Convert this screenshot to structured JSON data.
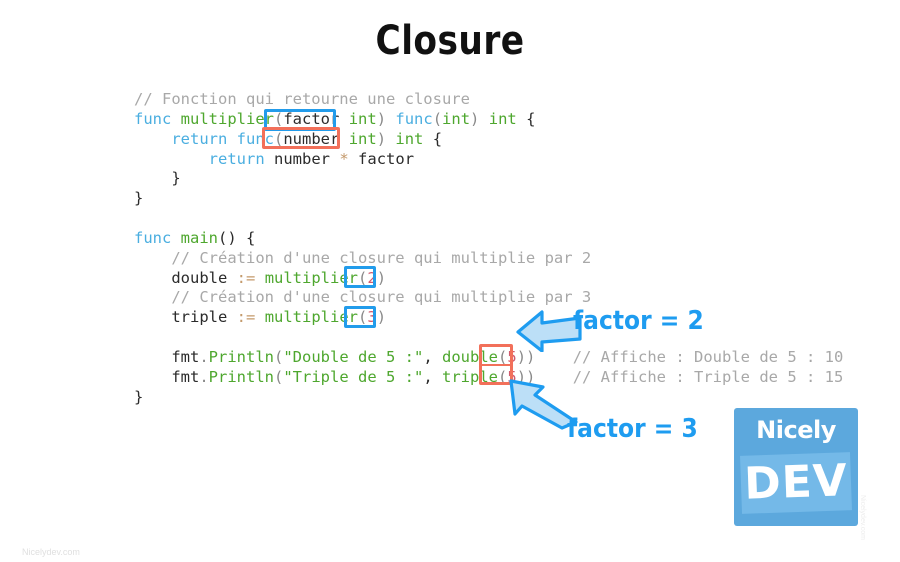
{
  "slide": {
    "title": "Closure",
    "background_color": "#ffffff"
  },
  "code": {
    "language": "go",
    "lines": [
      [
        {
          "t": "// Fonction qui retourne une closure",
          "c": "tok-com"
        }
      ],
      [
        {
          "t": "func",
          "c": "tok-kw"
        },
        {
          "t": " ",
          "c": "tok-plain"
        },
        {
          "t": "multiplier",
          "c": "tok-fn"
        },
        {
          "t": "(",
          "c": "tok-punct"
        },
        {
          "t": "factor",
          "c": "tok-ident"
        },
        {
          "t": " ",
          "c": "tok-plain"
        },
        {
          "t": "int",
          "c": "tok-type"
        },
        {
          "t": ")",
          "c": "tok-punct"
        },
        {
          "t": " ",
          "c": "tok-plain"
        },
        {
          "t": "func",
          "c": "tok-kw"
        },
        {
          "t": "(",
          "c": "tok-punct"
        },
        {
          "t": "int",
          "c": "tok-type"
        },
        {
          "t": ")",
          "c": "tok-punct"
        },
        {
          "t": " ",
          "c": "tok-plain"
        },
        {
          "t": "int",
          "c": "tok-type"
        },
        {
          "t": " {",
          "c": "tok-plain"
        }
      ],
      [
        {
          "t": "    ",
          "c": "tok-plain"
        },
        {
          "t": "return",
          "c": "tok-kw"
        },
        {
          "t": " ",
          "c": "tok-plain"
        },
        {
          "t": "func",
          "c": "tok-kw"
        },
        {
          "t": "(",
          "c": "tok-punct"
        },
        {
          "t": "number",
          "c": "tok-ident"
        },
        {
          "t": " ",
          "c": "tok-plain"
        },
        {
          "t": "int",
          "c": "tok-type"
        },
        {
          "t": ")",
          "c": "tok-punct"
        },
        {
          "t": " ",
          "c": "tok-plain"
        },
        {
          "t": "int",
          "c": "tok-type"
        },
        {
          "t": " {",
          "c": "tok-plain"
        }
      ],
      [
        {
          "t": "        ",
          "c": "tok-plain"
        },
        {
          "t": "return",
          "c": "tok-kw"
        },
        {
          "t": " ",
          "c": "tok-plain"
        },
        {
          "t": "number",
          "c": "tok-ident"
        },
        {
          "t": " ",
          "c": "tok-plain"
        },
        {
          "t": "*",
          "c": "tok-op"
        },
        {
          "t": " ",
          "c": "tok-plain"
        },
        {
          "t": "factor",
          "c": "tok-ident"
        }
      ],
      [
        {
          "t": "    }",
          "c": "tok-plain"
        }
      ],
      [
        {
          "t": "}",
          "c": "tok-plain"
        }
      ],
      [
        {
          "t": "",
          "c": "tok-plain"
        }
      ],
      [
        {
          "t": "func",
          "c": "tok-kw"
        },
        {
          "t": " ",
          "c": "tok-plain"
        },
        {
          "t": "main",
          "c": "tok-fn"
        },
        {
          "t": "() {",
          "c": "tok-plain"
        }
      ],
      [
        {
          "t": "    ",
          "c": "tok-plain"
        },
        {
          "t": "// Création d'une closure qui multiplie par 2",
          "c": "tok-com"
        }
      ],
      [
        {
          "t": "    ",
          "c": "tok-plain"
        },
        {
          "t": "double",
          "c": "tok-ident"
        },
        {
          "t": " ",
          "c": "tok-plain"
        },
        {
          "t": ":=",
          "c": "tok-op"
        },
        {
          "t": " ",
          "c": "tok-plain"
        },
        {
          "t": "multiplier",
          "c": "tok-fn"
        },
        {
          "t": "(",
          "c": "tok-punct"
        },
        {
          "t": "2",
          "c": "tok-num"
        },
        {
          "t": ")",
          "c": "tok-punct"
        }
      ],
      [
        {
          "t": "    ",
          "c": "tok-plain"
        },
        {
          "t": "// Création d'une closure qui multiplie par 3",
          "c": "tok-com"
        }
      ],
      [
        {
          "t": "    ",
          "c": "tok-plain"
        },
        {
          "t": "triple",
          "c": "tok-ident"
        },
        {
          "t": " ",
          "c": "tok-plain"
        },
        {
          "t": ":=",
          "c": "tok-op"
        },
        {
          "t": " ",
          "c": "tok-plain"
        },
        {
          "t": "multiplier",
          "c": "tok-fn"
        },
        {
          "t": "(",
          "c": "tok-punct"
        },
        {
          "t": "3",
          "c": "tok-num"
        },
        {
          "t": ")",
          "c": "tok-punct"
        }
      ],
      [
        {
          "t": "",
          "c": "tok-plain"
        }
      ],
      [
        {
          "t": "    ",
          "c": "tok-plain"
        },
        {
          "t": "fmt",
          "c": "tok-ident"
        },
        {
          "t": ".",
          "c": "tok-punct"
        },
        {
          "t": "Println",
          "c": "tok-fn"
        },
        {
          "t": "(",
          "c": "tok-punct"
        },
        {
          "t": "\"Double de 5 :\"",
          "c": "tok-str"
        },
        {
          "t": ", ",
          "c": "tok-plain"
        },
        {
          "t": "double",
          "c": "tok-fn"
        },
        {
          "t": "(",
          "c": "tok-punct"
        },
        {
          "t": "5",
          "c": "tok-num"
        },
        {
          "t": "))",
          "c": "tok-punct"
        },
        {
          "t": "    ",
          "c": "tok-plain"
        },
        {
          "t": "// Affiche : Double de 5 : 10",
          "c": "tok-com"
        }
      ],
      [
        {
          "t": "    ",
          "c": "tok-plain"
        },
        {
          "t": "fmt",
          "c": "tok-ident"
        },
        {
          "t": ".",
          "c": "tok-punct"
        },
        {
          "t": "Println",
          "c": "tok-fn"
        },
        {
          "t": "(",
          "c": "tok-punct"
        },
        {
          "t": "\"Triple de 5 :\"",
          "c": "tok-str"
        },
        {
          "t": ", ",
          "c": "tok-plain"
        },
        {
          "t": "triple",
          "c": "tok-fn"
        },
        {
          "t": "(",
          "c": "tok-punct"
        },
        {
          "t": "5",
          "c": "tok-num"
        },
        {
          "t": "))",
          "c": "tok-punct"
        },
        {
          "t": "    ",
          "c": "tok-plain"
        },
        {
          "t": "// Affiche : Triple de 5 : 15",
          "c": "tok-com"
        }
      ],
      [
        {
          "t": "}",
          "c": "tok-plain"
        }
      ]
    ]
  },
  "highlights": {
    "blue_color": "#229ceb",
    "red_color": "#f2705a",
    "boxes": [
      {
        "name": "factor-param",
        "token": "factor",
        "color": "blue"
      },
      {
        "name": "number-param",
        "token": "number",
        "color": "red"
      },
      {
        "name": "arg-two",
        "token": "(2)",
        "color": "blue"
      },
      {
        "name": "arg-three",
        "token": "(3)",
        "color": "blue"
      },
      {
        "name": "arg-fives",
        "token": "(5) (5)",
        "color": "red"
      }
    ]
  },
  "annotations": [
    {
      "name": "factor-equals-2",
      "label": "factor = 2",
      "color": "#1e9cf0",
      "arrow": "left-arrow"
    },
    {
      "name": "factor-equals-3",
      "label": "factor = 3",
      "color": "#1e9cf0",
      "arrow": "up-left-arrow"
    }
  ],
  "logo": {
    "line1": "Nicely",
    "line2": "DEV",
    "background_color": "#5ca8dd",
    "banner_color": "#74b9e8",
    "text_color": "#ffffff"
  },
  "watermarks": {
    "bottom_left": "Nicelydev.com",
    "right_edge": "Nicelydev.com"
  }
}
